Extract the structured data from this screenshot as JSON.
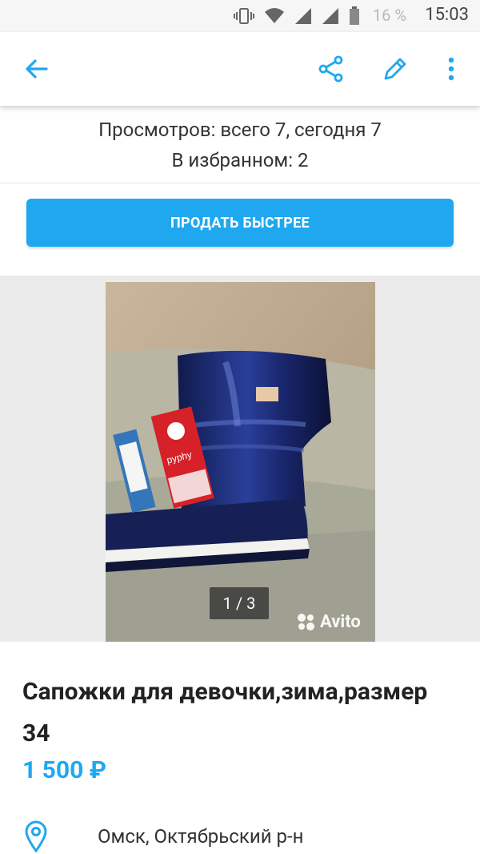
{
  "status_bar": {
    "battery_pct": "16 %",
    "time": "15:03",
    "icons": [
      "vibrate-icon",
      "wifi-icon",
      "signal-icon",
      "signal-icon",
      "battery-icon"
    ]
  },
  "app_bar": {
    "back_icon": "arrow-left-icon",
    "share_icon": "share-icon",
    "edit_icon": "pencil-icon",
    "more_icon": "more-vertical-icon",
    "accent": "#1fa8f0"
  },
  "stats": {
    "views": "Просмотров: всего 7, сегодня 7",
    "favorites": "В избранном: 2"
  },
  "sell_button": {
    "label": "ПРОДАТЬ БЫСТРЕЕ",
    "color": "#1fa8f0"
  },
  "gallery": {
    "counter": "1 / 3",
    "watermark": "Avito",
    "tag_text": "pyphy"
  },
  "listing": {
    "title": "Сапожки для девочки,зима,размер 34",
    "price": "1 500 ₽",
    "location": "Омск, Октябрьский р-н"
  }
}
